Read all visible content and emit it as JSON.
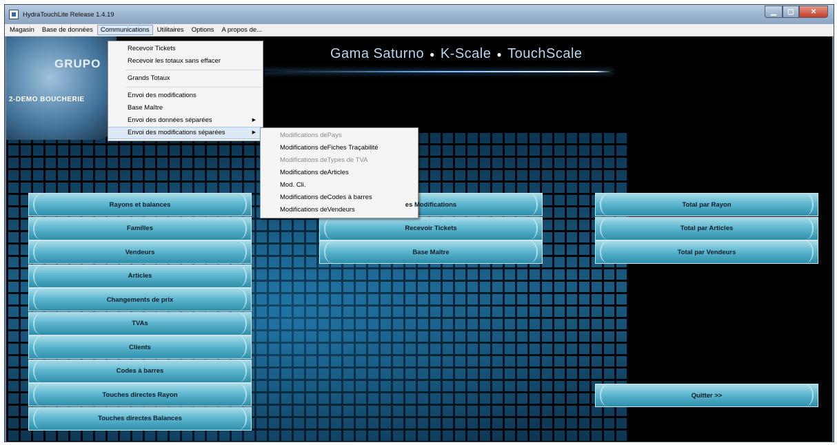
{
  "window": {
    "title": "HydraTouchLite Release 1.4.19"
  },
  "menubar": {
    "items": [
      "Magasin",
      "Base de données",
      "Communications",
      "Utilitaires",
      "Options",
      "A propos de..."
    ]
  },
  "logo": {
    "text": "GRUPO",
    "sub": "2-DEMO BOUCHERIE"
  },
  "banner": {
    "part1": "Gama Saturno",
    "part2": "K-Scale",
    "part3": "TouchScale"
  },
  "communications_menu": {
    "items": [
      {
        "label": "Recevoir Tickets"
      },
      {
        "label": "Recevoir les totaux sans effacer"
      },
      {
        "label": "Grands Totaux"
      },
      {
        "label": "Envoi des modifications"
      },
      {
        "label": "Base Maître"
      },
      {
        "label": "Envoi des données séparées"
      },
      {
        "label": "Envoi des modifications séparées"
      }
    ]
  },
  "submenu": {
    "items": [
      {
        "label": "Modifications dePays",
        "enabled": false
      },
      {
        "label": "Modifications deFiches Traçabilité",
        "enabled": true
      },
      {
        "label": "Modifications deTypes de TVA",
        "enabled": false
      },
      {
        "label": "Modifications deArticles",
        "enabled": true
      },
      {
        "label": "Mod. Cli.",
        "enabled": true
      },
      {
        "label": "Modifications deCodes à barres",
        "enabled": true
      },
      {
        "label": "Modifications deVendeurs",
        "enabled": true
      }
    ]
  },
  "left_buttons": [
    "Rayons et balances",
    "Familles",
    "Vendeurs",
    "Articles",
    "Changements de prix",
    "TVAs",
    "Clients",
    "Codes à barres",
    "Touches directes Rayon",
    "Touches directes Balances"
  ],
  "middle_buttons": [
    "es Modifications",
    "Recevoir Tickets",
    "Base Maître"
  ],
  "right_buttons": [
    "Total par Rayon",
    "Total par Articles",
    "Total par Vendeurs"
  ],
  "quit_button": "Quitter >>"
}
